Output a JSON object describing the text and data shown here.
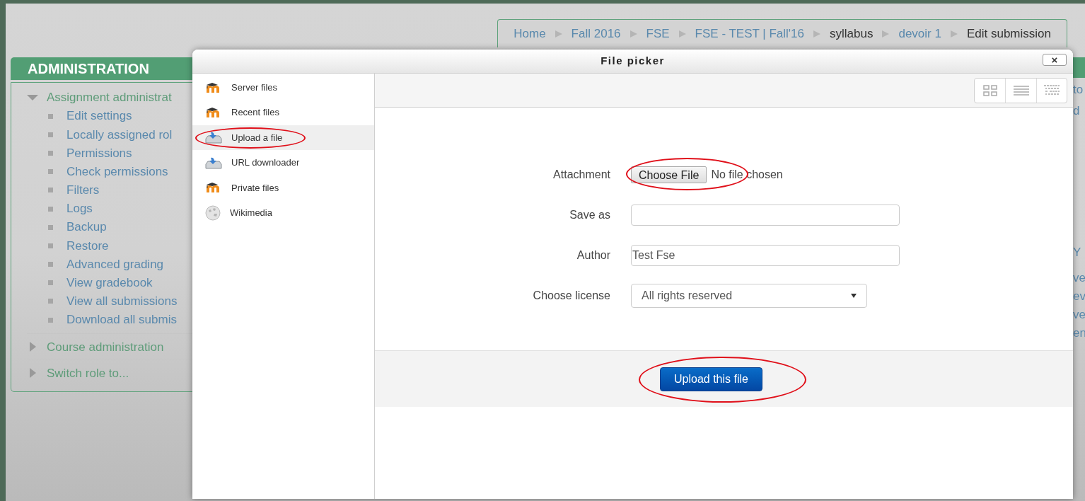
{
  "breadcrumb": [
    {
      "label": "Home",
      "link": true
    },
    {
      "label": "Fall 2016",
      "link": true
    },
    {
      "label": "FSE",
      "link": true
    },
    {
      "label": "FSE - TEST | Fall'16",
      "link": true
    },
    {
      "label": "syllabus",
      "link": false
    },
    {
      "label": "devoir 1",
      "link": true
    },
    {
      "label": "Edit submission",
      "link": false
    }
  ],
  "administration": {
    "title": "ADMINISTRATION",
    "items": [
      {
        "label": "Assignment administrat",
        "expanded": true,
        "children": [
          {
            "label": "Edit settings"
          },
          {
            "label": "Locally assigned rol"
          },
          {
            "label": "Permissions"
          },
          {
            "label": "Check permissions"
          },
          {
            "label": "Filters"
          },
          {
            "label": "Logs"
          },
          {
            "label": "Backup"
          },
          {
            "label": "Restore"
          },
          {
            "label": "Advanced grading"
          },
          {
            "label": "View gradebook"
          },
          {
            "label": "View all submissions"
          },
          {
            "label": "Download all submis"
          }
        ]
      },
      {
        "label": "Course administration",
        "expanded": false
      },
      {
        "label": "Switch role to...",
        "expanded": false
      }
    ]
  },
  "right_column_fragments": [
    "to",
    "d",
    "Y",
    "ve",
    "ev",
    "ve",
    "en"
  ],
  "file_picker": {
    "title": "File picker",
    "close": "×",
    "repositories": [
      {
        "label": "Server files",
        "kind": "moodle",
        "selected": false,
        "circled": false
      },
      {
        "label": "Recent files",
        "kind": "moodle",
        "selected": false,
        "circled": false
      },
      {
        "label": "Upload a file",
        "kind": "upload",
        "selected": true,
        "circled": true
      },
      {
        "label": "URL downloader",
        "kind": "upload",
        "selected": false,
        "circled": false
      },
      {
        "label": "Private files",
        "kind": "moodle",
        "selected": false,
        "circled": false
      },
      {
        "label": "Wikimedia",
        "kind": "globe",
        "selected": false,
        "circled": false
      }
    ],
    "form": [
      {
        "kind": "file",
        "label": "Attachment",
        "button": "Choose File",
        "status": "No file chosen",
        "circled": true
      },
      {
        "kind": "text",
        "label": "Save as"
      },
      {
        "kind": "text",
        "label": "Author",
        "value": "Test Fse"
      },
      {
        "kind": "select",
        "label": "Choose license",
        "value": "All rights reserved"
      }
    ],
    "submit": {
      "label": "Upload this file",
      "circled": true
    }
  }
}
